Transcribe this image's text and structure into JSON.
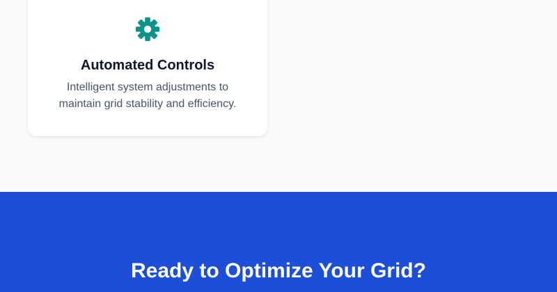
{
  "feature_card": {
    "icon": "gear-icon",
    "title": "Automated Controls",
    "description": "Intelligent system adjustments to maintain grid stability and efficiency."
  },
  "cta": {
    "heading": "Ready to Optimize Your Grid?"
  },
  "colors": {
    "page_background": "#f8fafc",
    "card_background": "#ffffff",
    "icon": "#0d9488",
    "title_text": "#0f172a",
    "body_text": "#475569",
    "cta_background": "#1d4ed8",
    "cta_text": "#ffffff"
  }
}
